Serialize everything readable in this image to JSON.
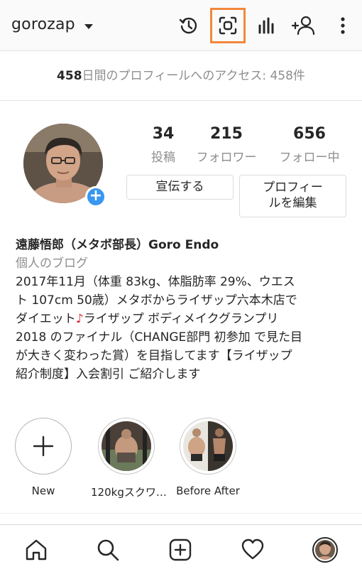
{
  "header": {
    "username": "gorozap",
    "icons": [
      "archive-clock-icon",
      "scan-qr-icon",
      "insights-icon",
      "add-person-icon",
      "more-vert-icon"
    ]
  },
  "access_banner": {
    "count": "458",
    "text": "日間のプロフィールへのアクセス: 458件"
  },
  "profile": {
    "stats": [
      {
        "value": "34",
        "label": "投稿"
      },
      {
        "value": "215",
        "label": "フォロワー"
      },
      {
        "value": "656",
        "label": "フォロー中"
      }
    ],
    "promote_label": "宣伝する",
    "edit_label_line1": "プロフィー",
    "edit_label_line2": "ルを編集"
  },
  "bio": {
    "name": "遠藤悟郎（メタボ部長）Goro Endo",
    "category": "個人のブログ",
    "line1": "2017年11月（体重 83kg、体脂肪率 29%、ウエス",
    "line2": "ト 107cm 50歳）メタボからライザップ六本木店で",
    "line3a": "ダイエット",
    "music_note": "♪",
    "line3b": "ライザップ ボディメイクグランプリ",
    "line4": "2018 のファイナル（CHANGE部門  初参加 で見た目",
    "line5": "が大きく変わった賞）を目指してます【ライザップ",
    "line6": "紹介制度】入会割引 ご紹介します"
  },
  "highlights": [
    {
      "label": "New"
    },
    {
      "label": "120kgスクワ…"
    },
    {
      "label": "Before After"
    }
  ],
  "bottom_nav": [
    "home-icon",
    "search-icon",
    "new-post-icon",
    "activity-heart-icon",
    "profile-avatar-icon"
  ],
  "colors": {
    "accent_blue": "#3897f0",
    "highlight_orange": "#f2873c",
    "music_red": "#e0202a",
    "muted_text": "#8e8e8e"
  }
}
